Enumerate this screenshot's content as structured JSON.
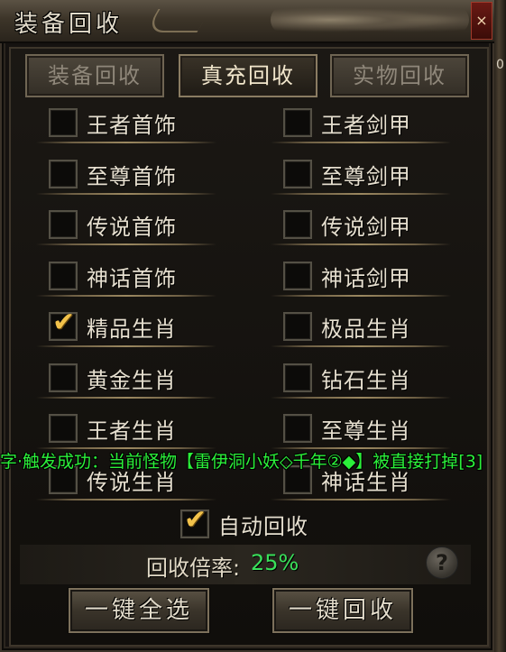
{
  "window": {
    "title": "装备回收",
    "close_label": "×"
  },
  "backdrop": {
    "edge_text": "0"
  },
  "tabs": [
    {
      "label": "装备回收",
      "state": "inactive"
    },
    {
      "label": "真充回收",
      "state": "active"
    },
    {
      "label": "实物回收",
      "state": "inactive"
    }
  ],
  "options": {
    "left": [
      {
        "label": "王者首饰",
        "checked": false
      },
      {
        "label": "至尊首饰",
        "checked": false
      },
      {
        "label": "传说首饰",
        "checked": false
      },
      {
        "label": "神话首饰",
        "checked": false
      },
      {
        "label": "精品生肖",
        "checked": true
      },
      {
        "label": "黄金生肖",
        "checked": false
      },
      {
        "label": "王者生肖",
        "checked": false
      },
      {
        "label": "传说生肖",
        "checked": false
      }
    ],
    "right": [
      {
        "label": "王者剑甲",
        "checked": false
      },
      {
        "label": "至尊剑甲",
        "checked": false
      },
      {
        "label": "传说剑甲",
        "checked": false
      },
      {
        "label": "神话剑甲",
        "checked": false
      },
      {
        "label": "极品生肖",
        "checked": false
      },
      {
        "label": "钻石生肖",
        "checked": false
      },
      {
        "label": "至尊生肖",
        "checked": false
      },
      {
        "label": "神话生肖",
        "checked": false
      }
    ]
  },
  "auto_recycle": {
    "label": "自动回收",
    "checked": true
  },
  "ratio": {
    "label": "回收倍率:",
    "value": "25%"
  },
  "help_label": "?",
  "buttons": {
    "select_all": "一键全选",
    "recycle_all": "一键回收"
  },
  "system_message": "字·触发成功：当前怪物【雷伊洞小妖◇千年②◆】被直接打掉[3]",
  "colors": {
    "message_green": "#2bf03a",
    "ratio_green": "#39e05a",
    "check_gold": "#f2c24a"
  }
}
